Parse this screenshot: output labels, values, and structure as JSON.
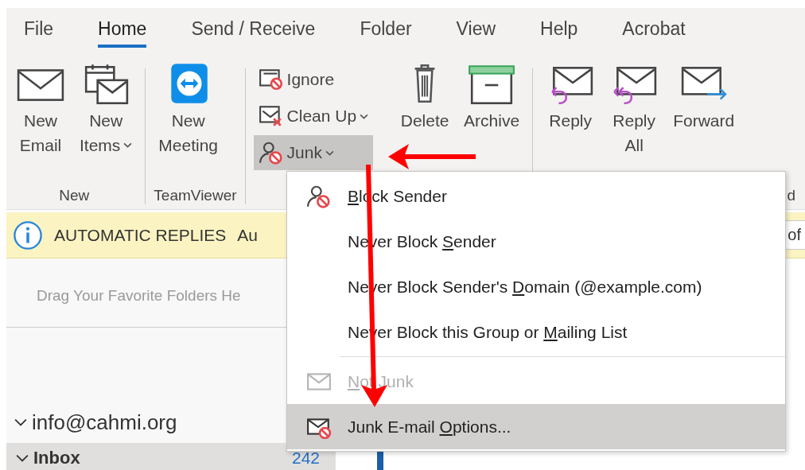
{
  "tabs": [
    {
      "label": "File",
      "selected": false
    },
    {
      "label": "Home",
      "selected": true
    },
    {
      "label": "Send / Receive",
      "selected": false
    },
    {
      "label": "Folder",
      "selected": false
    },
    {
      "label": "View",
      "selected": false
    },
    {
      "label": "Help",
      "selected": false
    },
    {
      "label": "Acrobat",
      "selected": false
    }
  ],
  "ribbon": {
    "groups": [
      {
        "label": "New",
        "large": [
          {
            "lines": [
              "New",
              "Email"
            ],
            "dropdown": false
          },
          {
            "lines": [
              "New",
              "Items"
            ],
            "dropdown": true
          }
        ]
      },
      {
        "label": "TeamViewer",
        "large": [
          {
            "lines": [
              "New",
              "Meeting"
            ],
            "dropdown": false
          }
        ]
      },
      {
        "small": [
          {
            "label": "Ignore",
            "dropdown": false,
            "pressed": false
          },
          {
            "label": "Clean Up",
            "dropdown": true,
            "pressed": false
          },
          {
            "label": "Junk",
            "dropdown": true,
            "pressed": true
          }
        ],
        "large": [
          {
            "lines": [
              "Delete"
            ],
            "dropdown": false
          },
          {
            "lines": [
              "Archive"
            ],
            "dropdown": false
          }
        ]
      },
      {
        "label": "d",
        "large": [
          {
            "lines": [
              "Reply"
            ],
            "dropdown": false
          },
          {
            "lines": [
              "Reply",
              "All"
            ],
            "dropdown": false
          },
          {
            "lines": [
              "Forward"
            ],
            "dropdown": false
          }
        ]
      }
    ]
  },
  "banner": {
    "title": "AUTOMATIC REPLIES",
    "text": "Au",
    "button": "of"
  },
  "sidebar": {
    "hint": "Drag Your Favorite Folders He",
    "account": {
      "label": "info@cahmi.org",
      "expanded": true
    },
    "folders": [
      {
        "label": "Inbox",
        "count": "242",
        "expanded": true,
        "selected": true
      }
    ]
  },
  "menu": {
    "items": [
      {
        "kind": "item",
        "key": "B",
        "post": "lock Sender",
        "disabled": false,
        "selected": false
      },
      {
        "kind": "item",
        "pre": "Never Block ",
        "key": "S",
        "post": "ender",
        "disabled": false,
        "selected": false
      },
      {
        "kind": "item",
        "pre": "Never Block Sender's ",
        "key": "D",
        "post": "omain (@example.com)",
        "disabled": false,
        "selected": false
      },
      {
        "kind": "item",
        "pre": "Never Block this Group or ",
        "key": "M",
        "post": "ailing List",
        "disabled": false,
        "selected": false
      },
      {
        "kind": "separator"
      },
      {
        "kind": "item",
        "key": "N",
        "post": "ot Junk",
        "disabled": true,
        "selected": false
      },
      {
        "kind": "item",
        "pre": "Junk E-mail ",
        "key": "O",
        "post": "ptions...",
        "disabled": false,
        "selected": true
      }
    ]
  }
}
